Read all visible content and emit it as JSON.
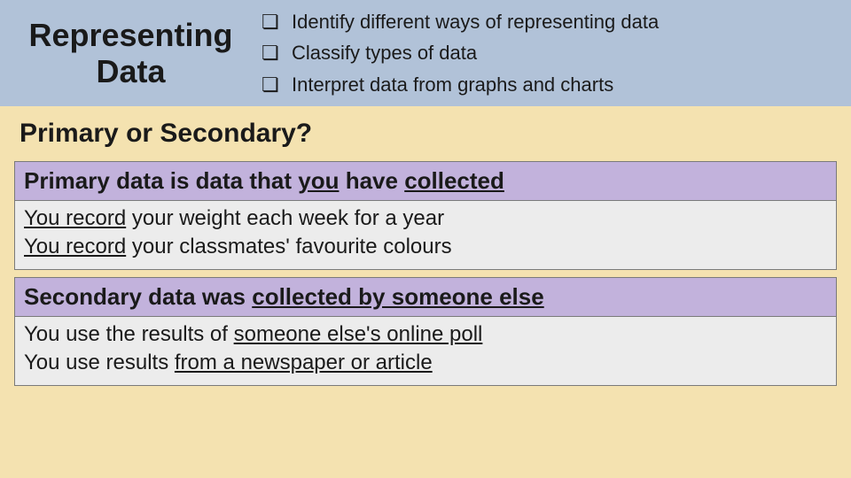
{
  "header": {
    "title_line1": "Representing",
    "title_line2": "Data",
    "objectives": [
      "Identify different ways of representing data",
      "Classify types of data",
      "Interpret data from graphs and charts"
    ]
  },
  "section_title": "Primary or Secondary?",
  "primary": {
    "heading_prefix": "Primary data is data that ",
    "heading_u1": "you",
    "heading_mid": " have ",
    "heading_u2": "collected",
    "ex1_u": "You record",
    "ex1_rest": " your weight each week for a year",
    "ex2_u": "You record",
    "ex2_rest": " your classmates' favourite colours"
  },
  "secondary": {
    "heading_prefix": "Secondary data was ",
    "heading_u1": "collected by someone else",
    "ex1_prefix": "You use the results of ",
    "ex1_u": "someone else's online poll",
    "ex2_prefix": "You use results ",
    "ex2_u": "from a newspaper or article"
  }
}
